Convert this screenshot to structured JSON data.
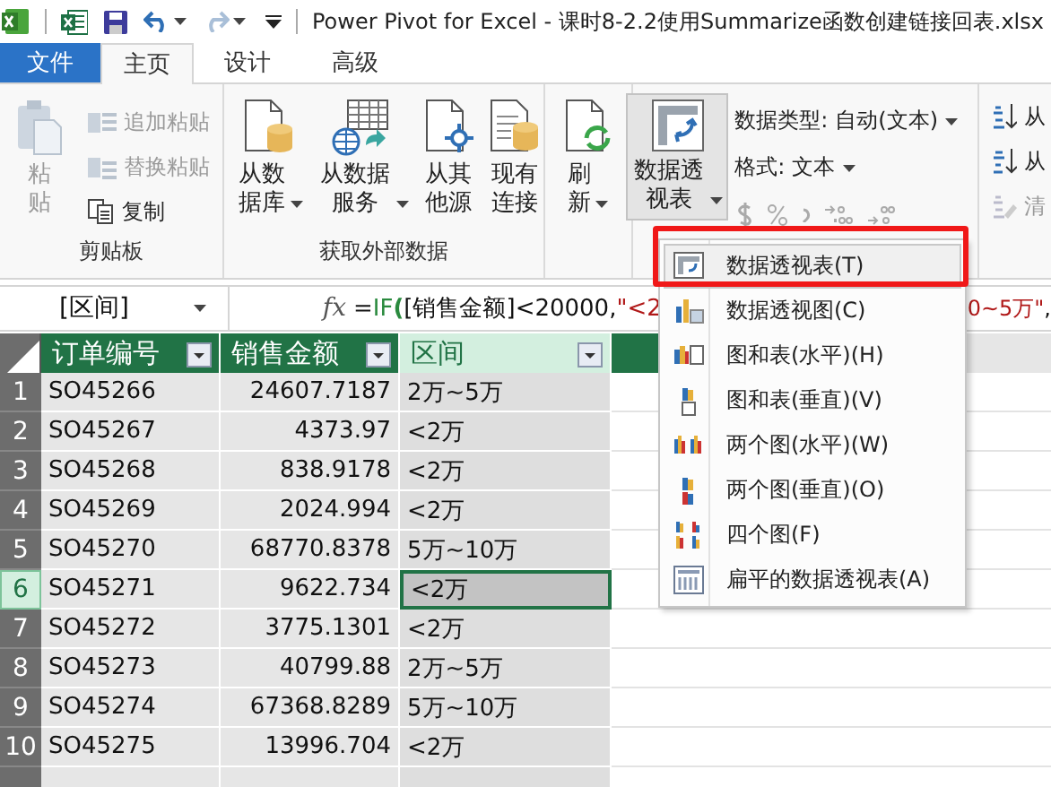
{
  "title_bar": {
    "title": "Power Pivot for Excel - 课时8-2.2使用Summarize函数创建链接回表.xlsx"
  },
  "tabs": [
    {
      "label": "文件",
      "kind": "file",
      "selected": false
    },
    {
      "label": "主页",
      "kind": "tab",
      "selected": true
    },
    {
      "label": "设计",
      "kind": "tab",
      "selected": false
    },
    {
      "label": "高级",
      "kind": "tab",
      "selected": false
    }
  ],
  "ribbon": {
    "clipboard": {
      "label": "剪贴板",
      "paste": {
        "label": "粘贴",
        "disabled": true
      },
      "items": [
        {
          "label": "追加粘贴",
          "disabled": true
        },
        {
          "label": "替换粘贴",
          "disabled": true
        },
        {
          "label": "复制",
          "disabled": false
        }
      ]
    },
    "external_data": {
      "label": "获取外部数据",
      "buttons": [
        {
          "label": "从数据库",
          "dropdown": true
        },
        {
          "label": "从数据服务",
          "dropdown": true
        },
        {
          "label": "从其他源",
          "dropdown": false
        },
        {
          "label": "现有连接",
          "dropdown": false
        }
      ]
    },
    "refresh": {
      "label": "刷新",
      "dropdown": true
    },
    "pivot_table": {
      "label": "数据透视表",
      "dropdown": true,
      "pressed": true
    },
    "formatting": {
      "data_type": {
        "label": "数据类型:",
        "value": "自动(文本)"
      },
      "format": {
        "label": "格式:",
        "value": "文本"
      },
      "number_buttons_disabled": true
    },
    "sort": {
      "items": [
        {
          "label": "从",
          "disabled": false
        },
        {
          "label": "从",
          "disabled": false
        },
        {
          "label": "清",
          "disabled": true
        }
      ]
    }
  },
  "formula_bar": {
    "name_box": "[区间]",
    "fx": "fx",
    "left": [
      {
        "text": "=",
        "kind": "plain"
      },
      {
        "text": "IF",
        "kind": "function"
      },
      {
        "text": "(",
        "kind": "paren"
      },
      {
        "text": "[销售金额]",
        "kind": "plain"
      },
      {
        "text": "<20000,",
        "kind": "plain"
      },
      {
        "text": "\"<2",
        "kind": "string"
      }
    ],
    "right": [
      {
        "text": "0~5万\"",
        "kind": "string"
      },
      {
        "text": ",",
        "kind": "plain"
      }
    ]
  },
  "grid": {
    "columns": [
      {
        "label": "订单编号",
        "selected": false
      },
      {
        "label": "销售金额",
        "selected": false
      },
      {
        "label": "区间",
        "selected": true
      }
    ],
    "rows": [
      {
        "number": "1",
        "cells": [
          "SO45266",
          "24607.7187",
          "2万~5万"
        ],
        "selected": false
      },
      {
        "number": "2",
        "cells": [
          "SO45267",
          "4373.97",
          "<2万"
        ],
        "selected": false
      },
      {
        "number": "3",
        "cells": [
          "SO45268",
          "838.9178",
          "<2万"
        ],
        "selected": false
      },
      {
        "number": "4",
        "cells": [
          "SO45269",
          "2024.994",
          "<2万"
        ],
        "selected": false
      },
      {
        "number": "5",
        "cells": [
          "SO45270",
          "68770.8378",
          "5万~10万"
        ],
        "selected": false
      },
      {
        "number": "6",
        "cells": [
          "SO45271",
          "9622.734",
          "<2万"
        ],
        "selected": true
      },
      {
        "number": "7",
        "cells": [
          "SO45272",
          "3775.1301",
          "<2万"
        ],
        "selected": false
      },
      {
        "number": "8",
        "cells": [
          "SO45273",
          "40799.88",
          "2万~5万"
        ],
        "selected": false
      },
      {
        "number": "9",
        "cells": [
          "SO45274",
          "67368.8289",
          "5万~10万"
        ],
        "selected": false
      },
      {
        "number": "10",
        "cells": [
          "SO45275",
          "13996.704",
          "<2万"
        ],
        "selected": false
      }
    ]
  },
  "pivot_menu": {
    "items": [
      {
        "label": "数据透视表(T)",
        "selected": true
      },
      {
        "label": "数据透视图(C)",
        "selected": false
      },
      {
        "label": "图和表(水平)(H)",
        "selected": false
      },
      {
        "label": "图和表(垂直)(V)",
        "selected": false
      },
      {
        "label": "两个图(水平)(W)",
        "selected": false
      },
      {
        "label": "两个图(垂直)(O)",
        "selected": false
      },
      {
        "label": "四个图(F)",
        "selected": false
      },
      {
        "label": "扁平的数据透视表(A)",
        "selected": false
      }
    ]
  }
}
